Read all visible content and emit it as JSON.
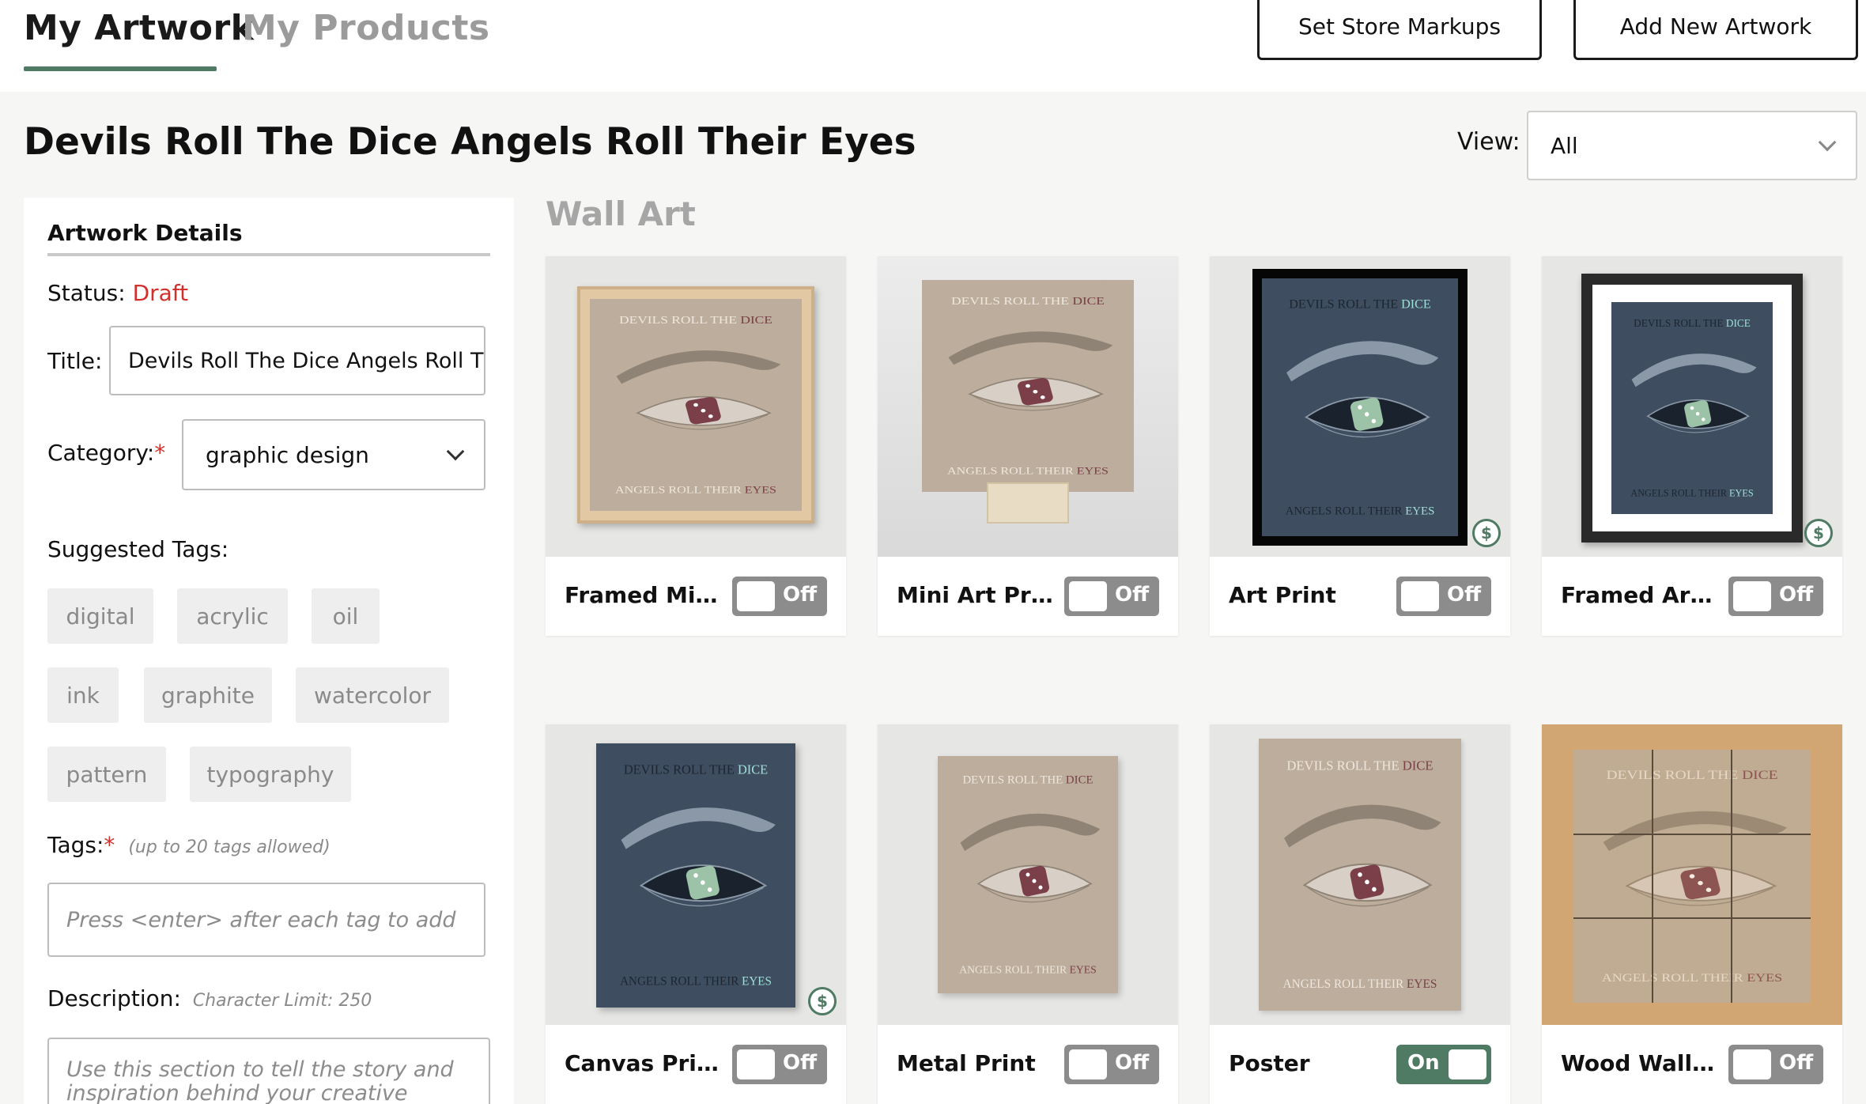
{
  "header": {
    "tabs": [
      "My Artwork",
      "My Products"
    ],
    "set_markups_label": "Set Store Markups",
    "add_artwork_label": "Add New Artwork"
  },
  "page_title": "Devils Roll The Dice Angels Roll Their Eyes",
  "view": {
    "label": "View:",
    "selected": "All"
  },
  "details": {
    "heading": "Artwork Details",
    "status_label": "Status:",
    "status_value": "Draft",
    "title_label": "Title:",
    "title_value": "Devils Roll The Dice Angels Roll Their Eyes",
    "category_label": "Category:",
    "required_mark": "*",
    "category_value": "graphic design",
    "suggested_tags_label": "Suggested Tags:",
    "suggested_tags": [
      "digital",
      "acrylic",
      "oil",
      "ink",
      "graphite",
      "watercolor",
      "pattern",
      "typography"
    ],
    "tags_label": "Tags:",
    "tags_hint": "(up to 20 tags allowed)",
    "tags_placeholder": "Press <enter> after each tag to add",
    "description_label": "Description:",
    "description_hint": "Character Limit: 250",
    "description_placeholder": "Use this section to tell the story and inspiration behind your creative"
  },
  "section_title": "Wall Art",
  "art_text": {
    "top": "DEVILS ROLL THE ",
    "top_accent": "DICE",
    "bottom": "ANGELS ROLL THEIR ",
    "bottom_accent": "EYES"
  },
  "currency_symbol": "$",
  "products": [
    {
      "name": "Framed Mini ...",
      "toggle": "Off",
      "state": "off",
      "style": "framed-mini",
      "price_icon": false
    },
    {
      "name": "Mini Art Print",
      "toggle": "Off",
      "state": "off",
      "style": "mini",
      "price_icon": false
    },
    {
      "name": "Art Print",
      "toggle": "Off",
      "state": "off",
      "style": "art-print",
      "price_icon": true
    },
    {
      "name": "Framed Art P...",
      "toggle": "Off",
      "state": "off",
      "style": "framed-art",
      "price_icon": true
    },
    {
      "name": "Canvas Print",
      "toggle": "Off",
      "state": "off",
      "style": "canvas",
      "price_icon": true
    },
    {
      "name": "Metal Print",
      "toggle": "Off",
      "state": "off",
      "style": "metal",
      "price_icon": false
    },
    {
      "name": "Poster",
      "toggle": "On",
      "state": "on",
      "style": "poster",
      "price_icon": false
    },
    {
      "name": "Wood Wall Art",
      "toggle": "Off",
      "state": "off",
      "style": "wood",
      "price_icon": false
    }
  ],
  "colors": {
    "accent_green": "#4f7a63",
    "draft_red": "#d0312d",
    "art_beige": "#bcad9c",
    "art_navy": "#3e4d60",
    "dice_maroon": "#7a3f48",
    "dice_mint": "#9cc3a8"
  }
}
